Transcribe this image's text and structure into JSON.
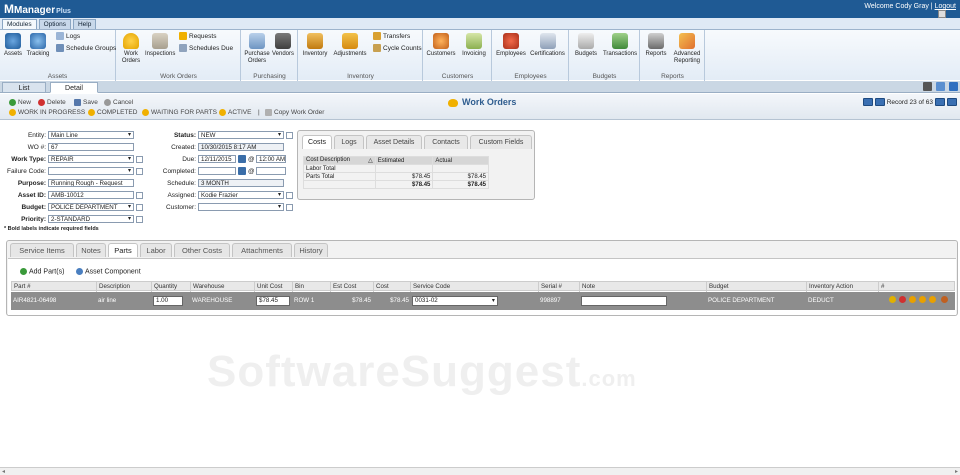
{
  "app": {
    "brand_main": "Manager",
    "brand_sub": "Plus",
    "welcome": "Welcome Cody Gray |",
    "logout": "Logout"
  },
  "ribbon": {
    "tabs": [
      "Modules",
      "Options",
      "Help"
    ],
    "groups": [
      {
        "label": "Assets",
        "items": [
          "Assets",
          "Tracking"
        ],
        "small": [
          "Logs",
          "Schedule Groups"
        ]
      },
      {
        "label": "Work Orders",
        "items": [
          "Work Orders",
          "Inspections"
        ],
        "small": [
          "Requests",
          "Schedules Due"
        ]
      },
      {
        "label": "Purchasing",
        "items": [
          "Purchase Orders",
          "Vendors"
        ]
      },
      {
        "label": "Inventory",
        "items": [
          "Inventory",
          "Adjustments"
        ],
        "small": [
          "Transfers",
          "Cycle Counts"
        ]
      },
      {
        "label": "Customers",
        "items": [
          "Customers",
          "Invoicing"
        ]
      },
      {
        "label": "Employees",
        "items": [
          "Employees",
          "Certifications"
        ]
      },
      {
        "label": "Budgets",
        "items": [
          "Budgets",
          "Transactions"
        ]
      },
      {
        "label": "Reports",
        "items": [
          "Reports",
          "Advanced Reporting"
        ]
      }
    ]
  },
  "view_tabs": [
    "List",
    "Detail"
  ],
  "toolbar": {
    "new": "New",
    "delete": "Delete",
    "save": "Save",
    "cancel": "Cancel",
    "wip": "WORK IN PROGRESS",
    "completed": "COMPLETED",
    "waiting": "WAITING FOR PARTS",
    "active": "ACTIVE",
    "sep": "|",
    "copy": "Copy Work Order"
  },
  "page_title": "Work Orders",
  "record": "Record 23 of 63",
  "form": {
    "entity_label": "Entity:",
    "entity": "Main Line",
    "wo_label": "WO #:",
    "wo": "67",
    "worktype_label": "Work Type:",
    "worktype": "REPAIR",
    "failure_label": "Failure Code:",
    "failure": "",
    "purpose_label": "Purpose:",
    "purpose": "Running Rough - Request",
    "asset_label": "Asset ID:",
    "asset": "AMB-10012",
    "budget_label": "Budget:",
    "budget": "POLICE DEPARTMENT",
    "priority_label": "Priority:",
    "priority": "2-STANDARD",
    "status_label": "Status:",
    "status": "NEW",
    "created_label": "Created:",
    "created": "10/30/2015 8:17 AM",
    "due_label": "Due:",
    "due_date": "12/11/2015",
    "due_time": "12:00 AM",
    "at": "@",
    "completed_label": "Completed:",
    "schedule_label": "Schedule:",
    "schedule": "3 MONTH",
    "assigned_label": "Assigned:",
    "assigned": "Kodie Frazier",
    "customer_label": "Customer:",
    "customer": ""
  },
  "note": "* Bold labels indicate required fields",
  "costs": {
    "tabs": [
      "Costs",
      "Logs",
      "Asset Details",
      "Contacts",
      "Custom Fields"
    ],
    "headers": [
      "Cost Description",
      "Estimated",
      "Actual"
    ],
    "rows": [
      {
        "desc": "Labor Total",
        "est": "",
        "act": ""
      },
      {
        "desc": "Parts Total",
        "est": "$78.45",
        "act": "$78.45"
      }
    ],
    "total": {
      "est": "$78.45",
      "act": "$78.45"
    }
  },
  "sub_tabs": [
    "Service Items",
    "Notes",
    "Parts",
    "Labor",
    "Other Costs",
    "Attachments",
    "History"
  ],
  "parts": {
    "add": "Add Part(s)",
    "asset_component": "Asset Component",
    "headers": [
      "Part #",
      "Description",
      "Quantity",
      "Warehouse",
      "Unit Cost",
      "Bin",
      "Est Cost",
      "Cost",
      "Service Code",
      "Serial #",
      "Note",
      "Budget",
      "Inventory Action",
      "#"
    ],
    "row": {
      "part": "AIR4821-06498",
      "desc": "air line",
      "qty": "1.00",
      "warehouse": "WAREHOUSE",
      "unit_cost": "$78.45",
      "bin": "ROW 1",
      "est_cost": "$78.45",
      "cost": "$78.45",
      "service_code": "0031-02",
      "serial": "998897",
      "note": "",
      "budget": "POLICE DEPARTMENT",
      "inv_action": "DEDUCT"
    }
  },
  "watermark": {
    "main": "SoftwareSuggest",
    "sub": ".com"
  }
}
